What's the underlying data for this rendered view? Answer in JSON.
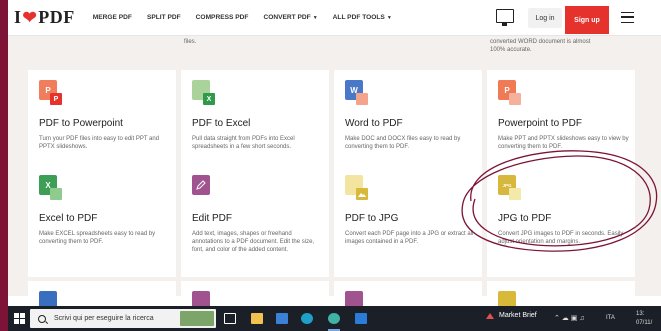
{
  "nav": {
    "logo_left": "I",
    "logo_right": "PDF",
    "links": [
      "MERGE PDF",
      "SPLIT PDF",
      "COMPRESS PDF",
      "CONVERT PDF",
      "ALL PDF TOOLS"
    ],
    "login_label": "Log in",
    "signup_label": "Sign up"
  },
  "fragments": {
    "top_left": "files.",
    "top_right_1": "converted WORD document is almost",
    "top_right_2": "100% accurate."
  },
  "tools": [
    {
      "title": "PDF to Powerpoint",
      "desc": "Turn your PDF files into easy to edit PPT and PPTX slideshows.",
      "icon_label": "P",
      "sub_label": "P",
      "icon_color": "#f07d5c",
      "sub_color": "#e5322d"
    },
    {
      "title": "PDF to Excel",
      "desc": "Pull data straight from PDFs into Excel spreadsheets in a few short seconds.",
      "icon_label": "",
      "sub_label": "X",
      "icon_color": "#a9d39a",
      "sub_color": "#2f9b4a"
    },
    {
      "title": "Word to PDF",
      "desc": "Make DOC and DOCX files easy to read by converting them to PDF.",
      "icon_label": "W",
      "sub_label": "",
      "icon_color": "#4a78c8",
      "sub_color": "#f4a48d"
    },
    {
      "title": "Powerpoint to PDF",
      "desc": "Make PPT and PPTX slideshows easy to view by converting them to PDF.",
      "icon_label": "P",
      "sub_label": "",
      "icon_color": "#ef7a55",
      "sub_color": "#f5b19c"
    },
    {
      "title": "Excel to PDF",
      "desc": "Make EXCEL spreadsheets easy to read by converting them to PDF.",
      "icon_label": "X",
      "sub_label": "",
      "icon_color": "#3d9e55",
      "sub_color": "#8fcb8f"
    },
    {
      "title": "Edit PDF",
      "desc": "Add text, images, shapes or freehand annotations to a PDF document. Edit the size, font, and color of the added content.",
      "icon_label": "",
      "sub_label": "",
      "icon_color": "#a0538f",
      "sub_color": "#a0538f"
    },
    {
      "title": "PDF to JPG",
      "desc": "Convert each PDF page into a JPG or extract all images contained in a PDF.",
      "icon_label": "",
      "sub_label": "",
      "icon_color": "#f3e5a0",
      "sub_color": "#d8b93a"
    },
    {
      "title": "JPG to PDF",
      "desc": "Convert JPG images to PDF in seconds. Easily adjust orientation and margins.",
      "icon_label": "JPG",
      "sub_label": "",
      "icon_color": "#d7b73c",
      "sub_color": "#f3e9a8"
    }
  ],
  "bottom_row_colors": [
    "#3a6fbf",
    "#a0538f",
    "#a0538f",
    "#d8b93a"
  ],
  "taskbar": {
    "search_placeholder": "Scrivi qui per eseguire la ricerca",
    "market_label": "Market Brief",
    "lang": "ITA",
    "clock_time": "13:",
    "clock_date": "07/11/"
  },
  "colors": {
    "brand_red": "#e5322d",
    "annotation_ink": "#7d1438"
  }
}
